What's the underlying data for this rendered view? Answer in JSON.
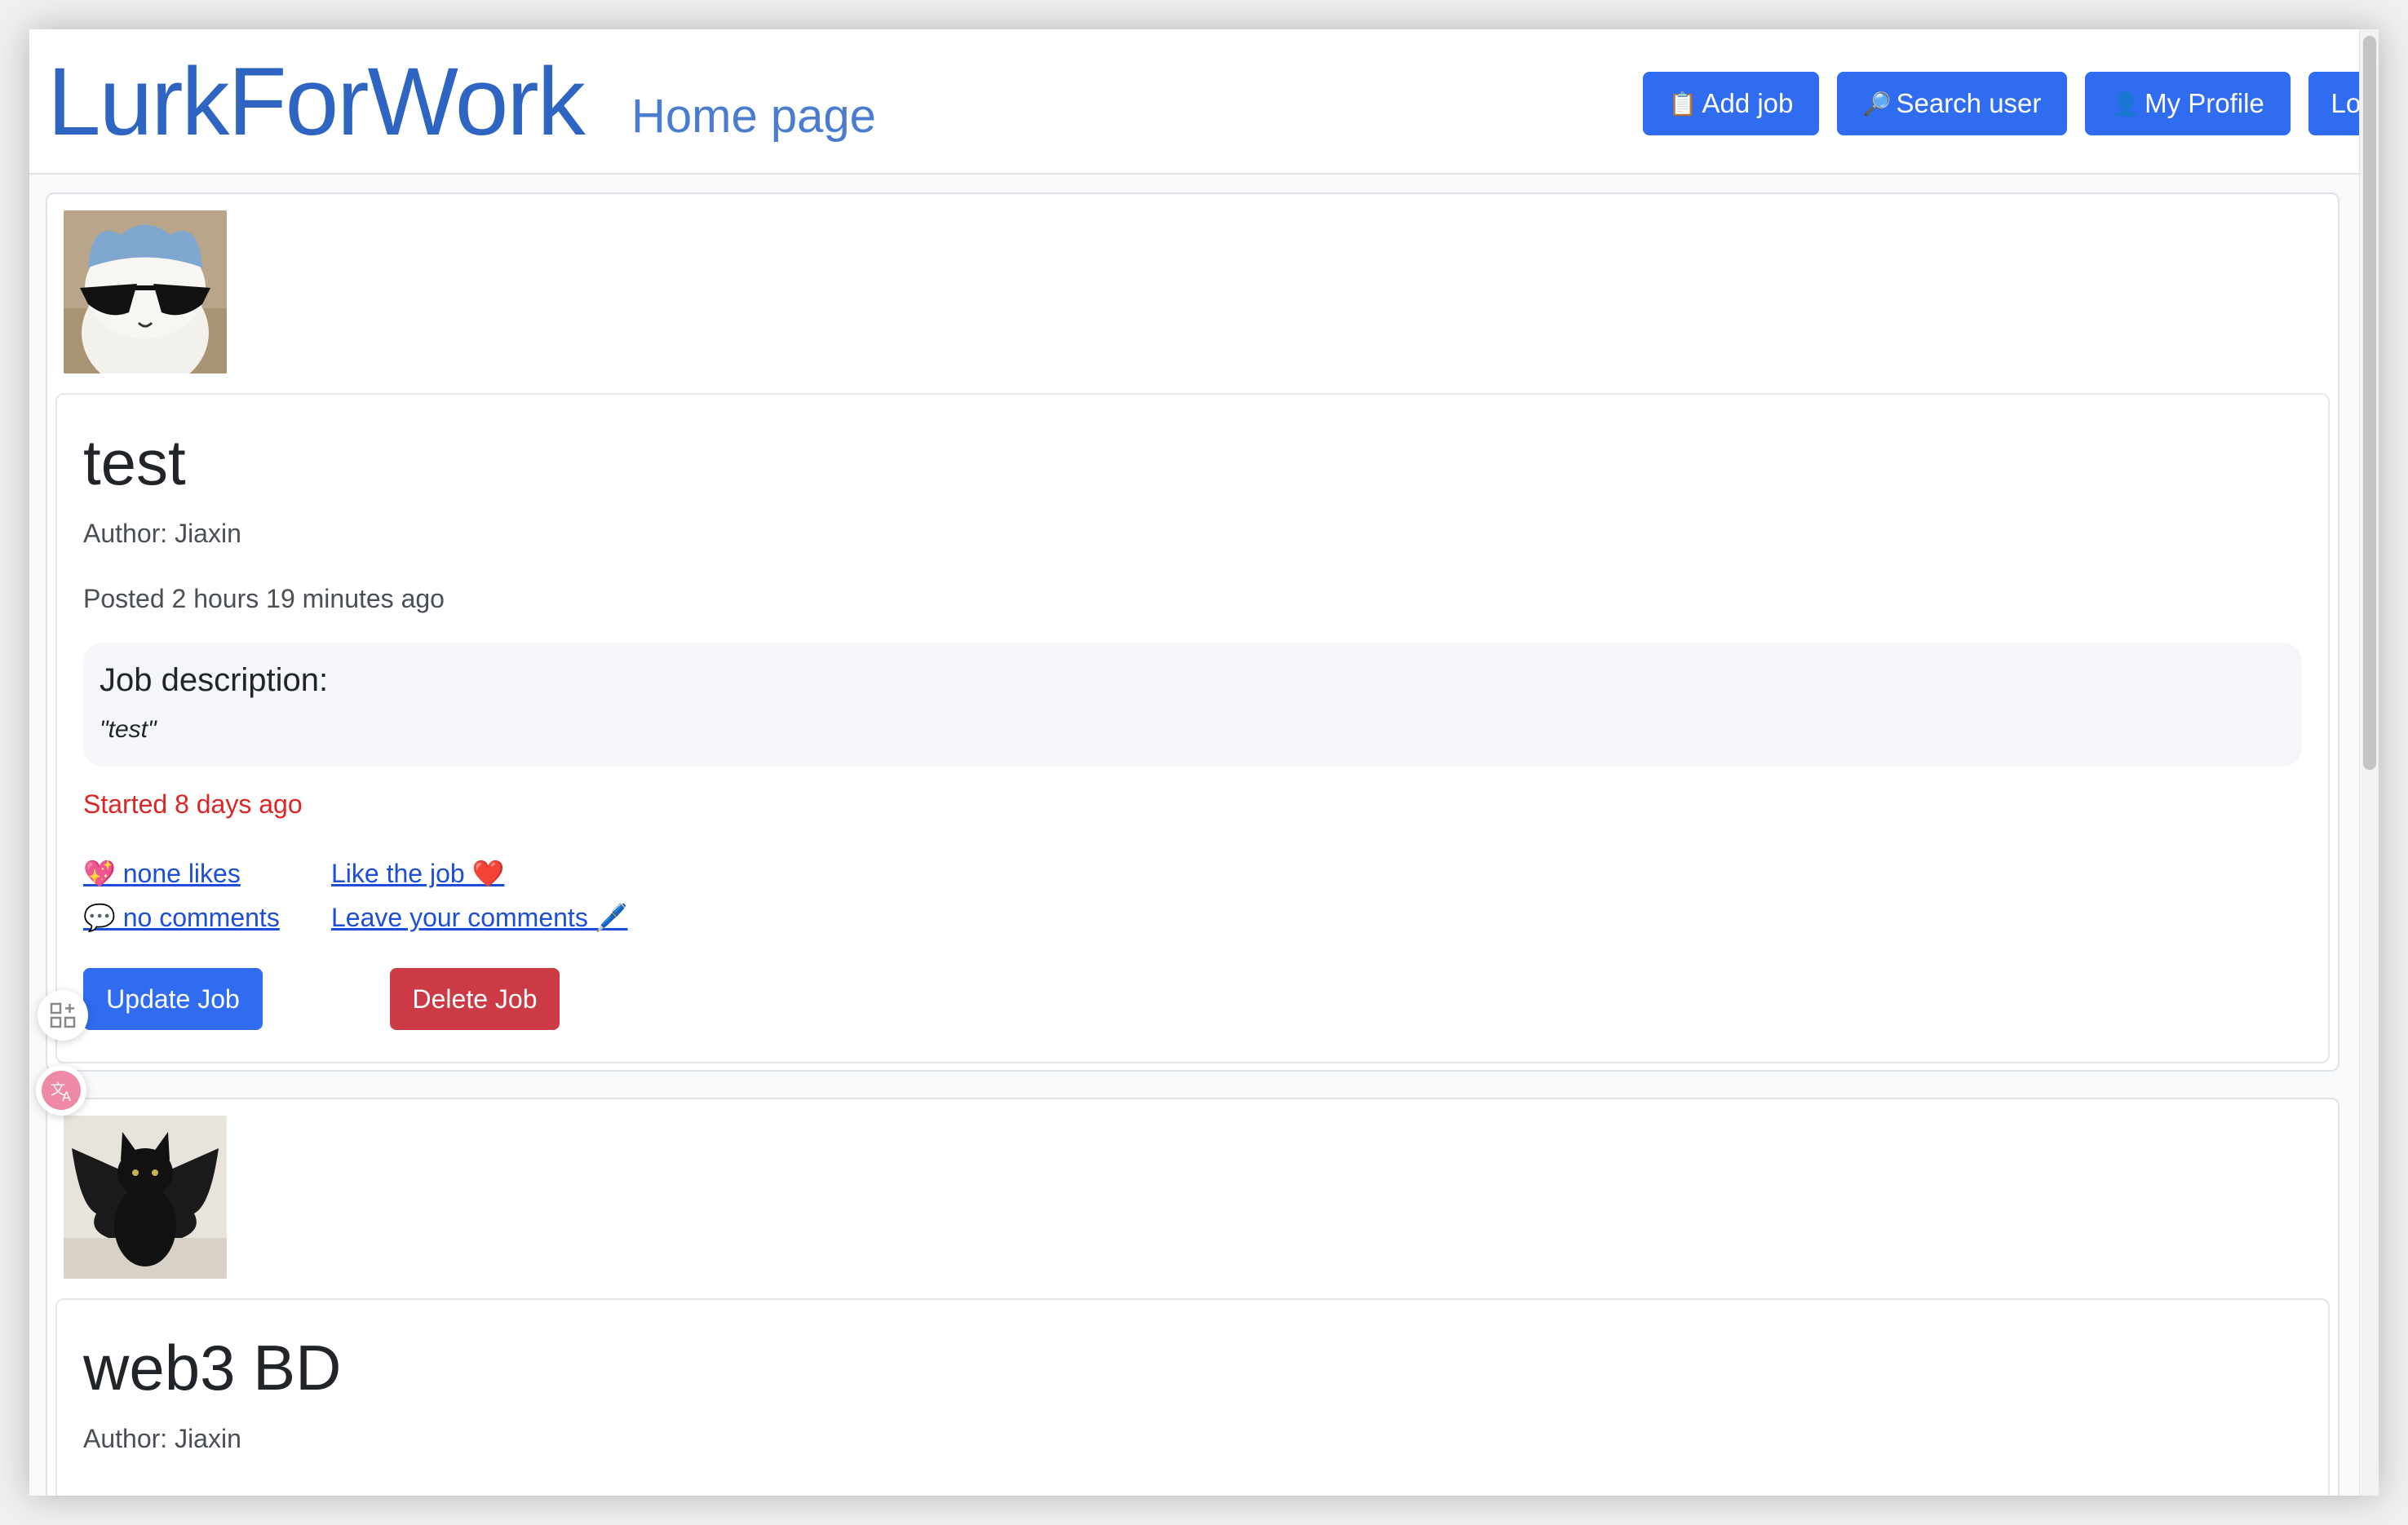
{
  "header": {
    "brand": "LurkForWork",
    "subtitle": "Home page",
    "buttons": {
      "add_job": "Add job",
      "search_user": "Search user",
      "my_profile": "My Profile",
      "logout": "Logout"
    },
    "icons": {
      "add_job": "📋",
      "search_user": "🔎",
      "my_profile": "👤"
    }
  },
  "jobs": [
    {
      "title": "test",
      "author": "Author: Jiaxin",
      "posted": "Posted 2 hours 19 minutes ago",
      "description_label": "Job description:",
      "description": "\"test\"",
      "started": "Started 8 days ago",
      "likes": "💖 none likes",
      "like_action": "Like the job ❤️",
      "comments": "💬 no comments",
      "comment_action": "Leave your comments 🖊️",
      "update_label": "Update Job",
      "delete_label": "Delete Job",
      "avatar": "cat-with-sunglasses"
    },
    {
      "title": "web3 BD",
      "author": "Author: Jiaxin",
      "avatar": "black-cat-with-bat-wings"
    }
  ],
  "colors": {
    "brand": "#2e64c2",
    "primary": "#2f6cf0",
    "danger": "#cc3b45",
    "started": "#dc2626",
    "link": "#1d4ed8"
  }
}
